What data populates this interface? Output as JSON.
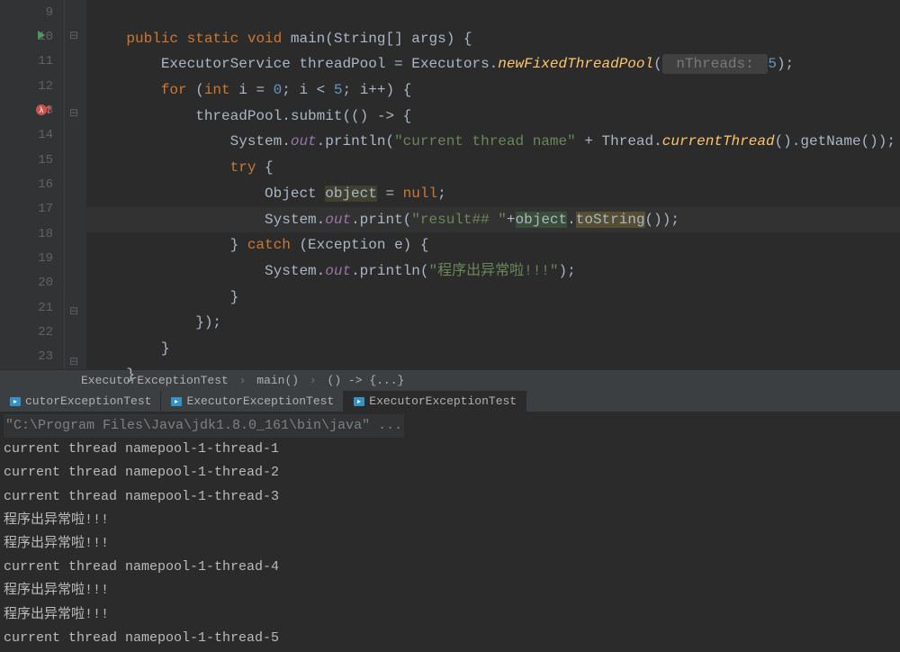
{
  "gutter": {
    "lines": [
      "9",
      "10",
      "11",
      "12",
      "13",
      "14",
      "15",
      "16",
      "17",
      "18",
      "19",
      "20",
      "21",
      "22",
      "23"
    ]
  },
  "code": {
    "l9": "",
    "l10_1": "public",
    "l10_2": "static",
    "l10_3": "void",
    "l10_4": "main",
    "l10_5": "(String[] args) {",
    "l11_1": "        ExecutorService threadPool = Executors.",
    "l11_2": "newFixedThreadPool",
    "l11_3": "(",
    "l11_hint": " nThreads: ",
    "l11_4": "5",
    "l11_5": ");",
    "l12_1": "for",
    "l12_2": " (",
    "l12_3": "int",
    "l12_4": " i = ",
    "l12_5": "0",
    "l12_6": "; i < ",
    "l12_7": "5",
    "l12_8": "; i++) {",
    "l13_1": "            threadPool.submit(() -> {",
    "l14_1": "                System.",
    "l14_2": "out",
    "l14_3": ".println(",
    "l14_4": "\"current thread name\"",
    "l14_5": " + Thread.",
    "l14_6": "currentThread",
    "l14_7": "().getName());",
    "l15_1": "try",
    "l15_2": " {",
    "l16_1": "                    Object ",
    "l16_2": "object",
    "l16_3": " = ",
    "l16_4": "null",
    "l16_5": ";",
    "l17_1": "                    System.",
    "l17_2": "out",
    "l17_3": ".print(",
    "l17_4": "\"result## \"",
    "l17_5": "+",
    "l17_6": "object",
    "l17_7": ".",
    "l17_8": "toString",
    "l17_9": "());",
    "l18_1": "                } ",
    "l18_2": "catch",
    "l18_3": " (Exception e) {",
    "l19_1": "                    System.",
    "l19_2": "out",
    "l19_3": ".println(",
    "l19_4": "\"程序出异常啦!!!\"",
    "l19_5": ");",
    "l20_1": "                }",
    "l21_1": "            });",
    "l22_1": "        }",
    "l23_1": "    }"
  },
  "breadcrumb": {
    "p1": "ExecutorExceptionTest",
    "p2": "main()",
    "p3": "() -> {...}"
  },
  "runTabs": {
    "t1": "cutorExceptionTest",
    "t2": "ExecutorExceptionTest",
    "t3": "ExecutorExceptionTest"
  },
  "console": {
    "cmd": "\"C:\\Program Files\\Java\\jdk1.8.0_161\\bin\\java\" ...",
    "l1": "current thread namepool-1-thread-1",
    "l2": "current thread namepool-1-thread-2",
    "l3": "current thread namepool-1-thread-3",
    "l4": "程序出异常啦!!!",
    "l5": "程序出异常啦!!!",
    "l6": "current thread namepool-1-thread-4",
    "l7": "程序出异常啦!!!",
    "l8": "程序出异常啦!!!",
    "l9": "current thread namepool-1-thread-5"
  }
}
